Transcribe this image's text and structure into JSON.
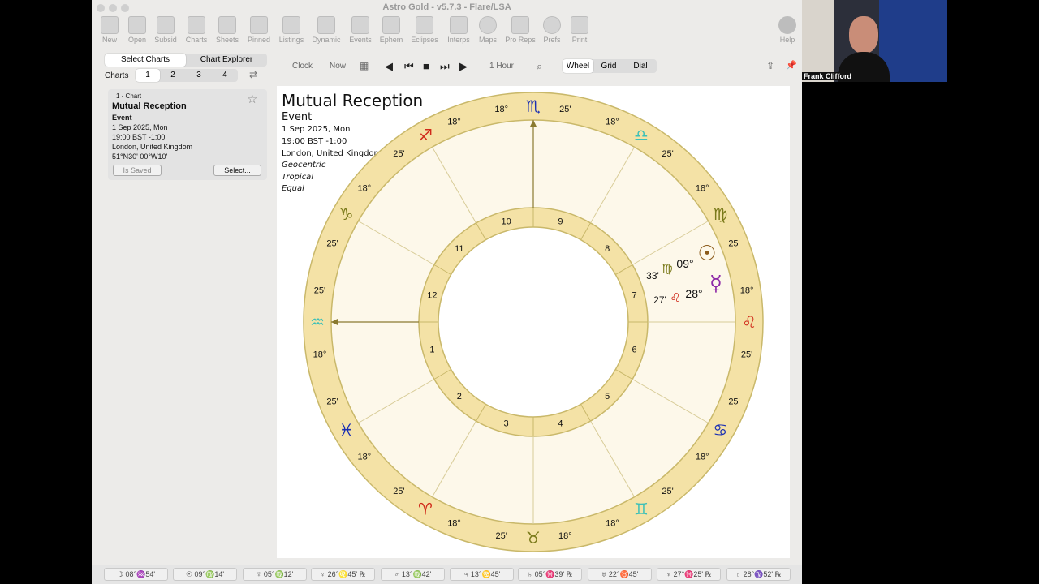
{
  "window": {
    "title": "Astro Gold - v5.7.3 - Flare/LSA"
  },
  "toolbar": {
    "items": [
      "New",
      "Open",
      "Subsid",
      "Charts",
      "Sheets",
      "Pinned",
      "Listings",
      "Dynamic",
      "Events",
      "Ephem",
      "Eclipses",
      "Interps",
      "Maps",
      "Pro Reps",
      "Prefs",
      "Print"
    ],
    "help": "Help"
  },
  "sidebar": {
    "tabs": [
      "Select Charts",
      "Chart Explorer"
    ],
    "charts_label": "Charts",
    "chart_numbers": [
      "1",
      "2",
      "3",
      "4"
    ],
    "card": {
      "number": "1 - Chart",
      "name": "Mutual Reception",
      "type": "Event",
      "date": "1 Sep 2025, Mon",
      "time": "19:00 BST -1:00",
      "place": "London, United Kingdom",
      "coords": "51°N30' 00°W10'",
      "saved_label": "Is Saved",
      "select_label": "Select..."
    }
  },
  "controls": {
    "clock": "Clock",
    "now": "Now",
    "step": "1 Hour",
    "views": [
      "Wheel",
      "Grid",
      "Dial"
    ]
  },
  "chart": {
    "title": "Mutual Reception",
    "type": "Event",
    "date": "1 Sep 2025, Mon",
    "time": "19:00 BST -1:00",
    "place": "London, United Kingdom",
    "method": "Geocentric",
    "zodiac": "Tropical",
    "houses": "Equal",
    "houses_numbers": [
      "1",
      "2",
      "3",
      "4",
      "5",
      "6",
      "7",
      "8",
      "9",
      "10",
      "11",
      "12"
    ],
    "colors": {
      "wheel": "#f4e2a6",
      "wheel_border": "#c9b86a",
      "inner": "#fdf8ea"
    }
  },
  "wheel_signs": [
    {
      "glyph": "♏",
      "deg1": "18°",
      "deg2": "25'",
      "color": "#1a2fb3"
    },
    {
      "glyph": "♎",
      "deg1": "18°",
      "deg2": "25'",
      "color": "#3cc0b8"
    },
    {
      "glyph": "♍",
      "deg1": "18°",
      "deg2": "25'",
      "color": "#7a7a1a"
    },
    {
      "glyph": "♌",
      "deg1": "18°",
      "deg2": "25'",
      "color": "#d02a1a"
    },
    {
      "glyph": "♋",
      "deg1": "25'",
      "deg2": "18°",
      "color": "#1a2fb3"
    },
    {
      "glyph": "♊",
      "deg1": "25'",
      "deg2": "18°",
      "color": "#3cc0b8"
    },
    {
      "glyph": "♉",
      "deg1": "18°",
      "deg2": "25'",
      "color": "#7a7a1a"
    },
    {
      "glyph": "♈",
      "deg1": "18°",
      "deg2": "25'",
      "color": "#d02a1a"
    },
    {
      "glyph": "♓",
      "deg1": "18°",
      "deg2": "25'",
      "color": "#1a2fb3"
    },
    {
      "glyph": "♒",
      "deg1": "18°",
      "deg2": "25'",
      "color": "#3cc0b8"
    },
    {
      "glyph": "♑",
      "deg1": "25'",
      "deg2": "18°",
      "color": "#7a7a1a"
    },
    {
      "glyph": "♐",
      "deg1": "25'",
      "deg2": "18°",
      "color": "#d02a1a"
    }
  ],
  "planets": [
    {
      "name": "sun",
      "glyph": "☉",
      "sign_glyph": "♍",
      "deg": "09°",
      "min": "33'",
      "color": "#8b5a1a",
      "sign_color": "#7a7a1a"
    },
    {
      "name": "mercury",
      "glyph": "☿",
      "sign_glyph": "♌",
      "deg": "28°",
      "min": "27'",
      "color": "#8e2aa8",
      "sign_color": "#d02a1a"
    }
  ],
  "status_bar": [
    "☽ 08°♒54'",
    "☉ 09°♍14'",
    "☿ 05°♍12'",
    "♀ 26°♌45' ℞",
    "♂ 13°♍42'",
    "♃ 13°♋45'",
    "♄ 05°♓39' ℞",
    "♅ 22°♉45'",
    "♆ 27°♓25' ℞",
    "♇ 28°♑52' ℞"
  ],
  "video": {
    "label": "Frank Clifford"
  }
}
